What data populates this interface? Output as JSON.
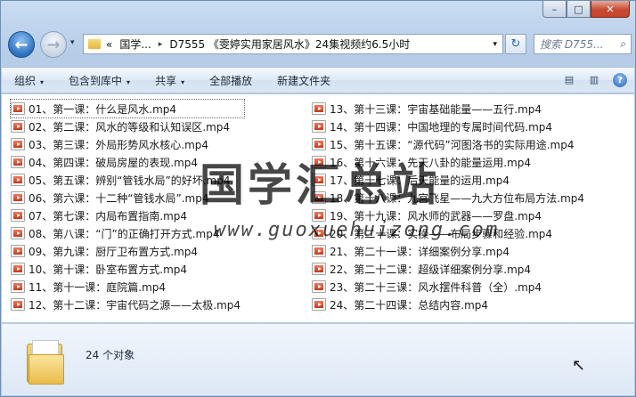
{
  "window": {
    "caption_buttons": {
      "minimize": "–",
      "maximize": "□",
      "close": "✕"
    }
  },
  "nav": {
    "back_glyph": "←",
    "forward_glyph": "→",
    "history_glyph": "▾",
    "address": {
      "overflow": "«",
      "parts": [
        "国学...",
        "D7555 《雯婷实用家居风水》24集视频约6.5小时"
      ],
      "separator": "▸",
      "dropdown_glyph": "▾"
    },
    "refresh_glyph": "↻",
    "search_placeholder": "搜索 D755...",
    "search_glyph": "⌕"
  },
  "toolbar": {
    "organize": "组织",
    "include_in_library": "包含到库中",
    "share": "共享",
    "play_all": "全部播放",
    "new_folder": "新建文件夹",
    "dd_glyph": "▾",
    "view_glyph": "▤",
    "pane_glyph": "▥",
    "help_glyph": "?"
  },
  "files_left": [
    "01、第一课：什么是风水.mp4",
    "02、第二课：风水的等级和认知误区.mp4",
    "03、第三课：外局形势风水核心.mp4",
    "04、第四课：破局房屋的表现.mp4",
    "05、第五课：辨别“管钱水局”的好坏.mp4",
    "06、第六课：十二种“管钱水局”.mp4",
    "07、第七课：内局布置指南.mp4",
    "08、第八课：“门”的正确打开方式.mp4",
    "09、第九课：厨厅卫布置方式.mp4",
    "10、第十课：卧室布置方式.mp4",
    "11、第十一课：庭院篇.mp4",
    "12、第十二课：宇宙代码之源——太极.mp4"
  ],
  "files_right": [
    "13、第十三课：宇宙基础能量——五行.mp4",
    "14、第十四课：中国地理的专属时间代码.mp4",
    "15、第十五课：“源代码”河图洛书的实际用途.mp4",
    "16、第十六课：先天八卦的能量运用.mp4",
    "17、第十七课：后天能量的运用.mp4",
    "18、第十八课：九宫飞星——九大方位布局方法.mp4",
    "19、第十九课：风水师的武器——罗盘.mp4",
    "20、第二十课：实操——布局步骤和经验.mp4",
    "21、第二十一课：详细案例分享.mp4",
    "22、第二十二课：超级详细案例分享.mp4",
    "23、第二十三课：风水摆件科普（全）.mp4",
    "24、第二十四课：总结内容.mp4"
  ],
  "watermark": {
    "title": "国学汇总站",
    "url": "www.guoxuehuizong.com"
  },
  "details": {
    "item_count": "24 个对象"
  }
}
